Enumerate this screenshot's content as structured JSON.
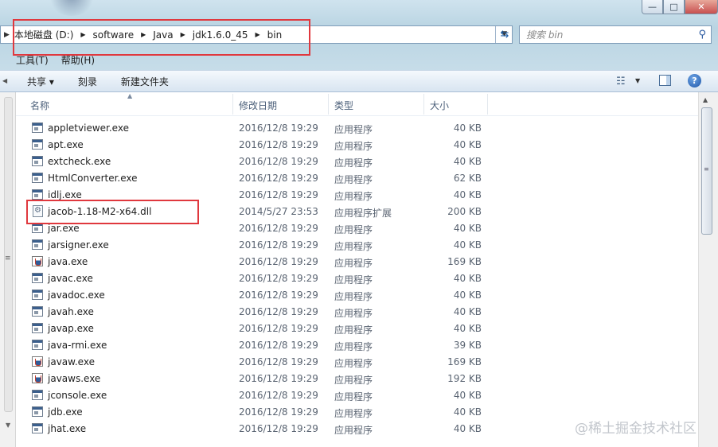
{
  "window": {
    "minimize_glyph": "—",
    "maximize_glyph": "□",
    "close_glyph": "✕"
  },
  "address_bar": {
    "crumbs": [
      "本地磁盘 (D:)",
      "software",
      "Java",
      "jdk1.6.0_45",
      "bin"
    ]
  },
  "search": {
    "placeholder": "搜索 bin"
  },
  "menu": {
    "tools": "工具(T)",
    "help": "帮助(H)"
  },
  "toolbar": {
    "share": "共享 ▾",
    "burn": "刻录",
    "new_folder": "新建文件夹"
  },
  "columns": {
    "name": "名称",
    "date": "修改日期",
    "type": "类型",
    "size": "大小"
  },
  "files": [
    {
      "name": "appletviewer.exe",
      "date": "2016/12/8 19:29",
      "type": "应用程序",
      "size": "40 KB",
      "icon": "exe"
    },
    {
      "name": "apt.exe",
      "date": "2016/12/8 19:29",
      "type": "应用程序",
      "size": "40 KB",
      "icon": "exe"
    },
    {
      "name": "extcheck.exe",
      "date": "2016/12/8 19:29",
      "type": "应用程序",
      "size": "40 KB",
      "icon": "exe"
    },
    {
      "name": "HtmlConverter.exe",
      "date": "2016/12/8 19:29",
      "type": "应用程序",
      "size": "62 KB",
      "icon": "exe"
    },
    {
      "name": "idlj.exe",
      "date": "2016/12/8 19:29",
      "type": "应用程序",
      "size": "40 KB",
      "icon": "exe"
    },
    {
      "name": "jacob-1.18-M2-x64.dll",
      "date": "2014/5/27 23:53",
      "type": "应用程序扩展",
      "size": "200 KB",
      "icon": "dll"
    },
    {
      "name": "jar.exe",
      "date": "2016/12/8 19:29",
      "type": "应用程序",
      "size": "40 KB",
      "icon": "exe"
    },
    {
      "name": "jarsigner.exe",
      "date": "2016/12/8 19:29",
      "type": "应用程序",
      "size": "40 KB",
      "icon": "exe"
    },
    {
      "name": "java.exe",
      "date": "2016/12/8 19:29",
      "type": "应用程序",
      "size": "169 KB",
      "icon": "java"
    },
    {
      "name": "javac.exe",
      "date": "2016/12/8 19:29",
      "type": "应用程序",
      "size": "40 KB",
      "icon": "exe"
    },
    {
      "name": "javadoc.exe",
      "date": "2016/12/8 19:29",
      "type": "应用程序",
      "size": "40 KB",
      "icon": "exe"
    },
    {
      "name": "javah.exe",
      "date": "2016/12/8 19:29",
      "type": "应用程序",
      "size": "40 KB",
      "icon": "exe"
    },
    {
      "name": "javap.exe",
      "date": "2016/12/8 19:29",
      "type": "应用程序",
      "size": "40 KB",
      "icon": "exe"
    },
    {
      "name": "java-rmi.exe",
      "date": "2016/12/8 19:29",
      "type": "应用程序",
      "size": "39 KB",
      "icon": "exe"
    },
    {
      "name": "javaw.exe",
      "date": "2016/12/8 19:29",
      "type": "应用程序",
      "size": "169 KB",
      "icon": "java"
    },
    {
      "name": "javaws.exe",
      "date": "2016/12/8 19:29",
      "type": "应用程序",
      "size": "192 KB",
      "icon": "java"
    },
    {
      "name": "jconsole.exe",
      "date": "2016/12/8 19:29",
      "type": "应用程序",
      "size": "40 KB",
      "icon": "exe"
    },
    {
      "name": "jdb.exe",
      "date": "2016/12/8 19:29",
      "type": "应用程序",
      "size": "40 KB",
      "icon": "exe"
    },
    {
      "name": "jhat.exe",
      "date": "2016/12/8 19:29",
      "type": "应用程序",
      "size": "40 KB",
      "icon": "exe"
    }
  ],
  "watermark": "@稀土掘金技术社区",
  "accent_colors": {
    "highlight": "#e0383e",
    "toolbar": "#dde8f3"
  }
}
